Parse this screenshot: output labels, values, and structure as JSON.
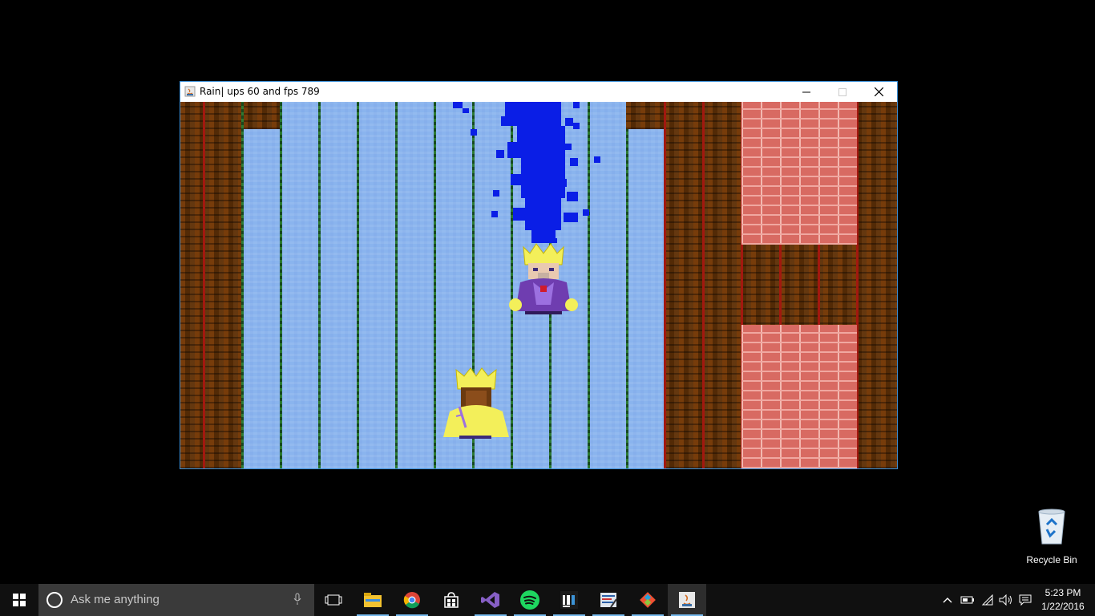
{
  "window": {
    "title": "Rain| ups 60 and fps 789",
    "controls": {
      "minimize": "minimize",
      "maximize": "maximize",
      "close": "close"
    }
  },
  "desktop": {
    "icons": [
      {
        "label": "Recycle Bin",
        "icon": "recycle-bin-icon"
      }
    ]
  },
  "taskbar": {
    "search_placeholder": "Ask me anything",
    "pinned": [
      {
        "name": "task-view",
        "icon": "task-view-icon"
      },
      {
        "name": "file-explorer",
        "icon": "folder-icon"
      },
      {
        "name": "chrome",
        "icon": "chrome-icon"
      },
      {
        "name": "store",
        "icon": "store-icon"
      },
      {
        "name": "visual-studio",
        "icon": "visual-studio-icon"
      },
      {
        "name": "spotify",
        "icon": "spotify-icon"
      },
      {
        "name": "intellij",
        "icon": "intellij-icon"
      },
      {
        "name": "editor",
        "icon": "editor-icon"
      },
      {
        "name": "git",
        "icon": "git-icon"
      },
      {
        "name": "java-app",
        "icon": "java-icon"
      }
    ],
    "time": "5:23 PM",
    "date": "1/22/2016"
  },
  "colors": {
    "wood": "#6b3b10",
    "wood_divider": "#a2180f",
    "water": "#8ab4ee",
    "lane_line": "#1f5a28",
    "brick": "#d86a62",
    "rain": "#0a1ee6",
    "accent": "#76b9ed"
  }
}
